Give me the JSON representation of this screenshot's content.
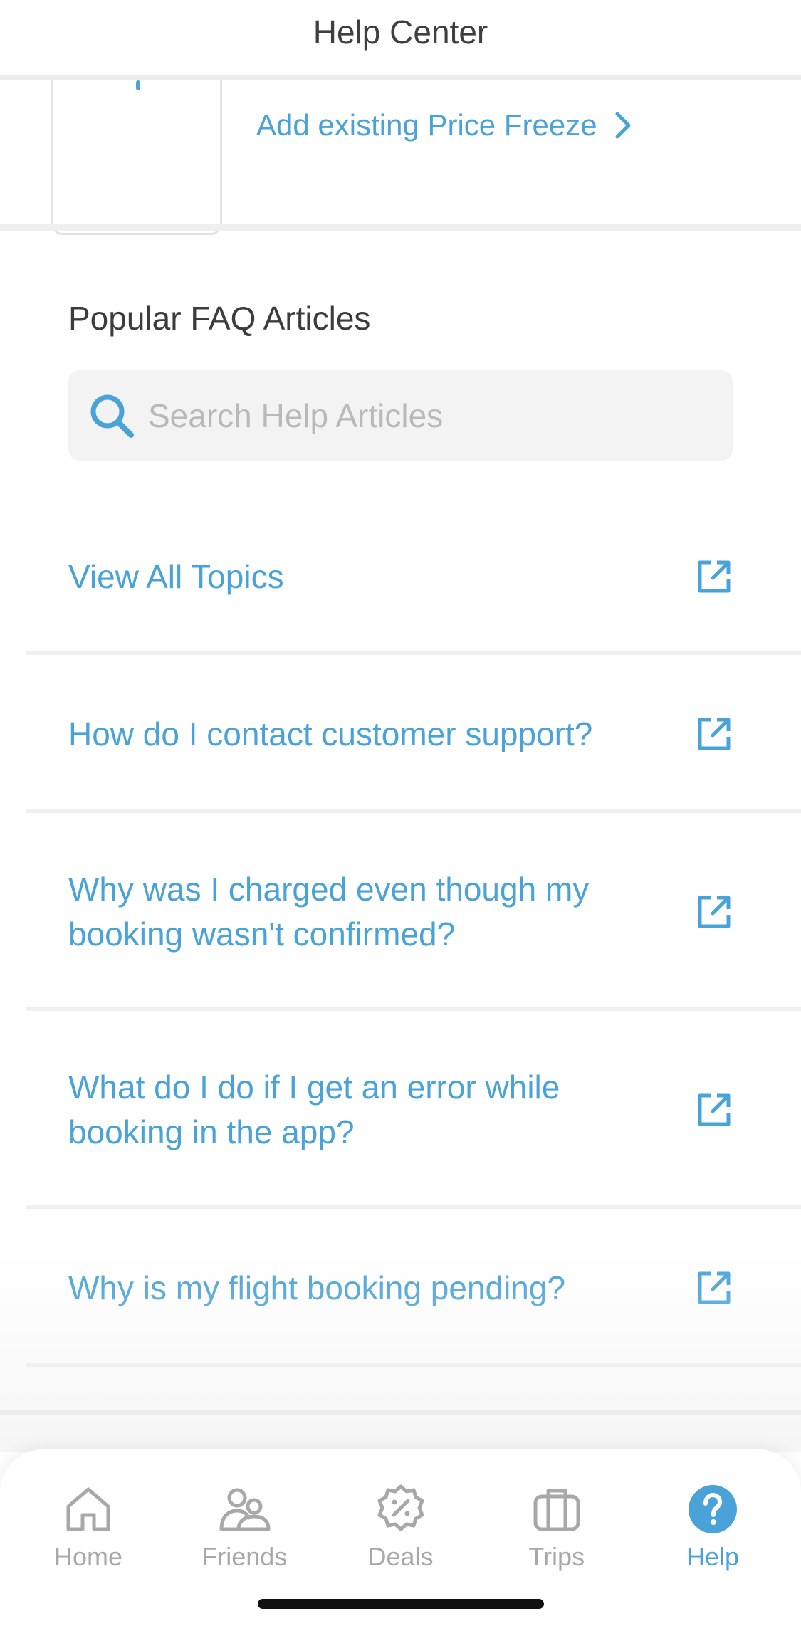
{
  "header": {
    "title": "Help Center"
  },
  "price_freeze": {
    "link_label": "Add existing Price Freeze"
  },
  "faq": {
    "heading": "Popular FAQ Articles",
    "search_placeholder": "Search Help Articles",
    "items": [
      {
        "label": "View All Topics"
      },
      {
        "label": "How do I contact customer support?"
      },
      {
        "label": "Why was I charged even though my booking wasn't confirmed?"
      },
      {
        "label": "What do I do if I get an error while booking in the app?"
      },
      {
        "label": "Why is my flight booking pending?"
      }
    ]
  },
  "tabbar": {
    "tabs": [
      {
        "label": "Home",
        "icon": "home-icon"
      },
      {
        "label": "Friends",
        "icon": "friends-icon"
      },
      {
        "label": "Deals",
        "icon": "deals-icon"
      },
      {
        "label": "Trips",
        "icon": "trips-icon"
      },
      {
        "label": "Help",
        "icon": "help-icon",
        "active": true
      }
    ]
  },
  "colors": {
    "accent": "#4aa3d8",
    "inactive": "#a8a8a8",
    "text": "#3c3c3c"
  }
}
